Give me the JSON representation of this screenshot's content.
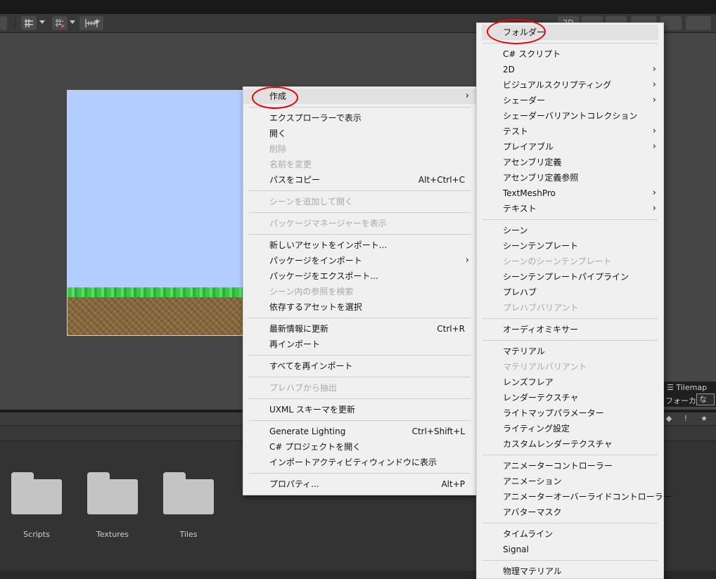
{
  "scene_toolbar": {
    "buttons": [
      "2D"
    ]
  },
  "tilemap_overlay": {
    "title": "Tilemap",
    "focus_label": "フォーカス",
    "focus_value": "な"
  },
  "project": {
    "assets": [
      {
        "name": "Scripts",
        "icon": "folder-icon"
      },
      {
        "name": "Textures",
        "icon": "folder-icon"
      },
      {
        "name": "Tiles",
        "icon": "folder-icon"
      }
    ]
  },
  "context_menu": {
    "items": [
      {
        "label": "作成",
        "submenu": true,
        "highlighted": true
      },
      {
        "sep": true
      },
      {
        "label": "エクスプローラーで表示"
      },
      {
        "label": "開く"
      },
      {
        "label": "削除",
        "disabled": true
      },
      {
        "label": "名前を変更",
        "disabled": true
      },
      {
        "label": "パスをコピー",
        "shortcut": "Alt+Ctrl+C"
      },
      {
        "sep": true
      },
      {
        "label": "シーンを追加して開く",
        "disabled": true
      },
      {
        "sep": true
      },
      {
        "label": "パッケージマネージャーを表示",
        "disabled": true
      },
      {
        "sep": true
      },
      {
        "label": "新しいアセットをインポート..."
      },
      {
        "label": "パッケージをインポート",
        "submenu": true
      },
      {
        "label": "パッケージをエクスポート..."
      },
      {
        "label": "シーン内の参照を検索",
        "disabled": true
      },
      {
        "label": "依存するアセットを選択"
      },
      {
        "sep": true
      },
      {
        "label": "最新情報に更新",
        "shortcut": "Ctrl+R"
      },
      {
        "label": "再インポート"
      },
      {
        "sep": true
      },
      {
        "label": "すべてを再インポート"
      },
      {
        "sep": true
      },
      {
        "label": "プレハブから抽出",
        "disabled": true
      },
      {
        "sep": true
      },
      {
        "label": "UXML スキーマを更新"
      },
      {
        "sep": true
      },
      {
        "label": "Generate Lighting",
        "shortcut": "Ctrl+Shift+L"
      },
      {
        "label": "C# プロジェクトを開く"
      },
      {
        "label": "インポートアクティビティウィンドウに表示"
      },
      {
        "sep": true
      },
      {
        "label": "プロパティ...",
        "shortcut": "Alt+P"
      }
    ]
  },
  "create_submenu": {
    "items": [
      {
        "label": "フォルダー",
        "highlighted": true
      },
      {
        "sep": true
      },
      {
        "label": "C# スクリプト"
      },
      {
        "label": "2D",
        "submenu": true
      },
      {
        "label": "ビジュアルスクリプティング",
        "submenu": true
      },
      {
        "label": "シェーダー",
        "submenu": true
      },
      {
        "label": "シェーダーバリアントコレクション"
      },
      {
        "label": "テスト",
        "submenu": true
      },
      {
        "label": "プレイアブル",
        "submenu": true
      },
      {
        "label": "アセンブリ定義"
      },
      {
        "label": "アセンブリ定義参照"
      },
      {
        "label": "TextMeshPro",
        "submenu": true
      },
      {
        "label": "テキスト",
        "submenu": true
      },
      {
        "sep": true
      },
      {
        "label": "シーン"
      },
      {
        "label": "シーンテンプレート"
      },
      {
        "label": "シーンのシーンテンプレート",
        "disabled": true
      },
      {
        "label": "シーンテンプレートパイプライン"
      },
      {
        "label": "プレハブ"
      },
      {
        "label": "プレハブバリアント",
        "disabled": true
      },
      {
        "sep": true
      },
      {
        "label": "オーディオミキサー"
      },
      {
        "sep": true
      },
      {
        "label": "マテリアル"
      },
      {
        "label": "マテリアルバリアント",
        "disabled": true
      },
      {
        "label": "レンズフレア"
      },
      {
        "label": "レンダーテクスチャ"
      },
      {
        "label": "ライトマップパラメーター"
      },
      {
        "label": "ライティング設定"
      },
      {
        "label": "カスタムレンダーテクスチャ"
      },
      {
        "sep": true
      },
      {
        "label": "アニメーターコントローラー"
      },
      {
        "label": "アニメーション"
      },
      {
        "label": "アニメーターオーバーライドコントローラー"
      },
      {
        "label": "アバターマスク"
      },
      {
        "sep": true
      },
      {
        "label": "タイムライン"
      },
      {
        "label": "Signal"
      },
      {
        "sep": true
      },
      {
        "label": "物理マテリアル"
      }
    ]
  },
  "colors": {
    "menu_bg": "#f0f0f0",
    "sky": "#b3cdff",
    "annotation": "#ee0000"
  }
}
